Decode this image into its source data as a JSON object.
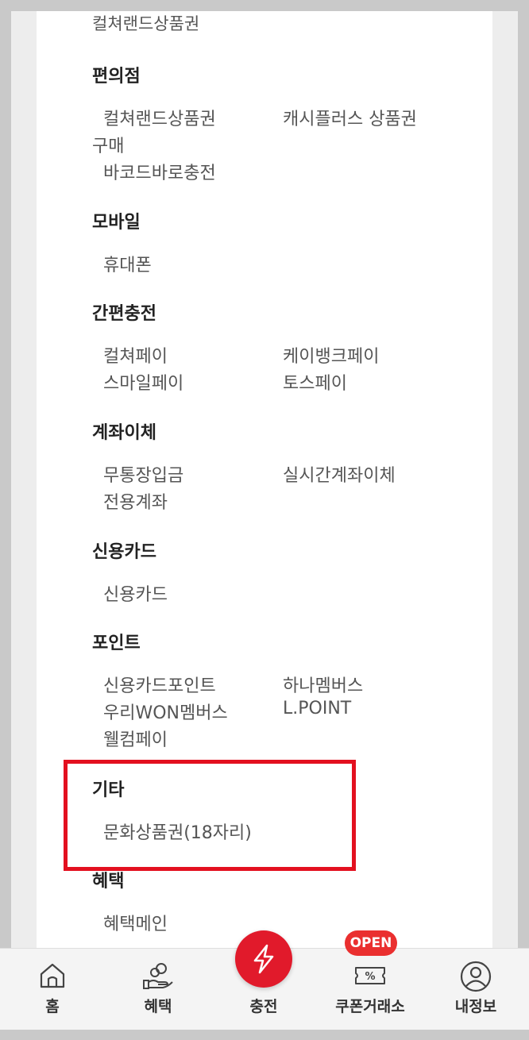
{
  "top_item": "컬쳐랜드상품권",
  "sections": [
    {
      "title": "편의점",
      "items": [
        "컬쳐랜드상품권",
        "캐시플러스 상품권",
        "구매",
        "바코드바로충전"
      ]
    },
    {
      "title": "모바일",
      "items": [
        "휴대폰"
      ]
    },
    {
      "title": "간편충전",
      "items": [
        "컬쳐페이",
        "케이뱅크페이",
        "스마일페이",
        "토스페이"
      ]
    },
    {
      "title": "계좌이체",
      "items": [
        "무통장입금",
        "실시간계좌이체",
        "전용계좌"
      ]
    },
    {
      "title": "신용카드",
      "items": [
        "신용카드"
      ]
    },
    {
      "title": "포인트",
      "items": [
        "신용카드포인트",
        "하나멤버스",
        "우리WON멤버스",
        "L.POINT",
        "웰컴페이"
      ]
    },
    {
      "title": "기타",
      "items": [
        "문화상품권(18자리)"
      ]
    },
    {
      "title": "혜택",
      "items": [
        "혜택메인"
      ]
    }
  ],
  "bottom_nav": {
    "home": "홈",
    "benefit": "혜택",
    "charge": "충전",
    "coupon": "쿠폰거래소",
    "myinfo": "내정보",
    "open_badge": "OPEN"
  },
  "colors": {
    "accent": "#e11a2b",
    "highlight_border": "#e3101f"
  }
}
